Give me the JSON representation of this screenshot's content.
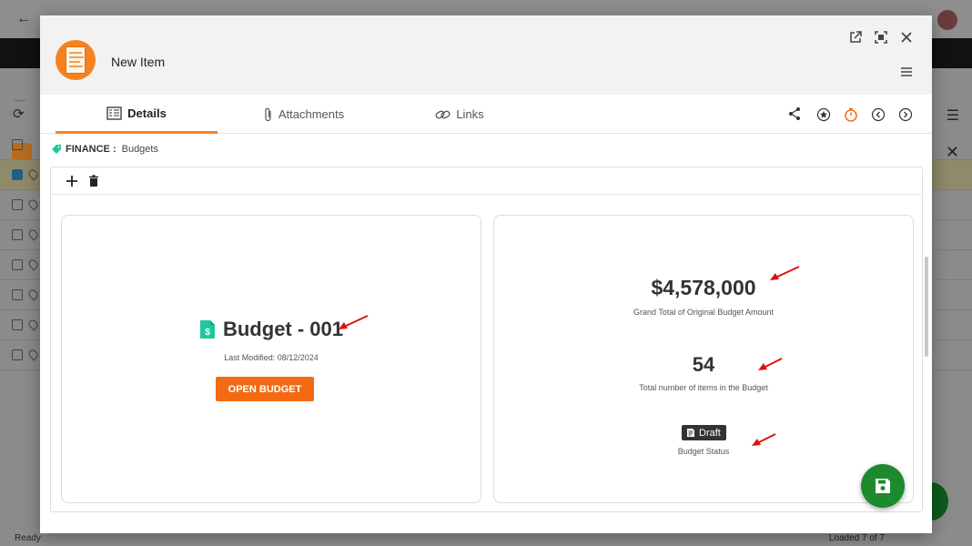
{
  "window": {
    "title": "New Item"
  },
  "tabs": [
    {
      "label": "Details",
      "active": true
    },
    {
      "label": "Attachments",
      "active": false
    },
    {
      "label": "Links",
      "active": false
    }
  ],
  "breadcrumb": {
    "module": "FINANCE :",
    "section": "Budgets"
  },
  "budget": {
    "name": "Budget - 001",
    "last_modified": "Last Modified: 08/12/2024",
    "open_button": "OPEN BUDGET"
  },
  "stats": {
    "grand_total": "$4,578,000",
    "grand_total_label": "Grand Total of Original Budget Amount",
    "item_count": "54",
    "item_count_label": "Total number of items in the Budget",
    "status": "Draft",
    "status_label": "Budget Status"
  },
  "statusbar": {
    "left": "Ready",
    "right": "Loaded 7 of 7"
  },
  "colors": {
    "accent": "#f26b12",
    "save": "#1e8a2e",
    "module_icon": "#1fc7a0",
    "annotation_arrow": "#e01010"
  },
  "icons": {
    "header": [
      "open-external-icon",
      "fullscreen-icon",
      "close-icon",
      "menu-icon"
    ],
    "tab_tools": [
      "share-icon",
      "star-icon",
      "timer-icon",
      "chevron-left-icon",
      "chevron-right-icon"
    ],
    "content_toolbar": [
      "add-icon",
      "delete-icon"
    ]
  }
}
